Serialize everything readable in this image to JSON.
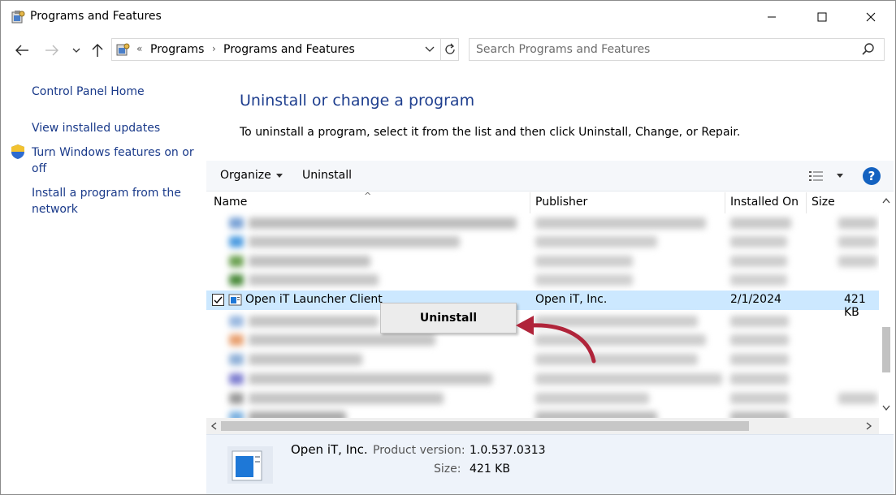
{
  "window": {
    "title": "Programs and Features"
  },
  "address_bar": {
    "overflow_chevron": "«",
    "crumbs": [
      "Programs",
      "Programs and Features"
    ]
  },
  "search": {
    "placeholder": "Search Programs and Features"
  },
  "left_pane": {
    "links": [
      "Control Panel Home",
      "View installed updates",
      "Turn Windows features on or off",
      "Install a program from the network"
    ]
  },
  "main": {
    "title": "Uninstall or change a program",
    "description": "To uninstall a program, select it from the list and then click Uninstall, Change, or Repair."
  },
  "toolbar": {
    "organize_label": "Organize",
    "uninstall_label": "Uninstall",
    "help_label": "?"
  },
  "list": {
    "columns": [
      "Name",
      "Publisher",
      "Installed On",
      "Size"
    ],
    "selected_row": {
      "name": "Open iT Launcher Client",
      "publisher": "Open iT, Inc.",
      "installed_on": "2/1/2024",
      "size": "421 KB",
      "checked": true
    }
  },
  "context_menu": {
    "items": [
      "Uninstall"
    ]
  },
  "details": {
    "publisher": "Open iT, Inc.",
    "product_version_label": "Product version:",
    "product_version": "1.0.537.0313",
    "size_label": "Size:",
    "size": "421 KB"
  },
  "colors": {
    "link": "#1a3a8a",
    "title": "#1e3e8e",
    "selection": "#cce8ff",
    "arrow": "#b0243a",
    "help": "#1462c0"
  }
}
